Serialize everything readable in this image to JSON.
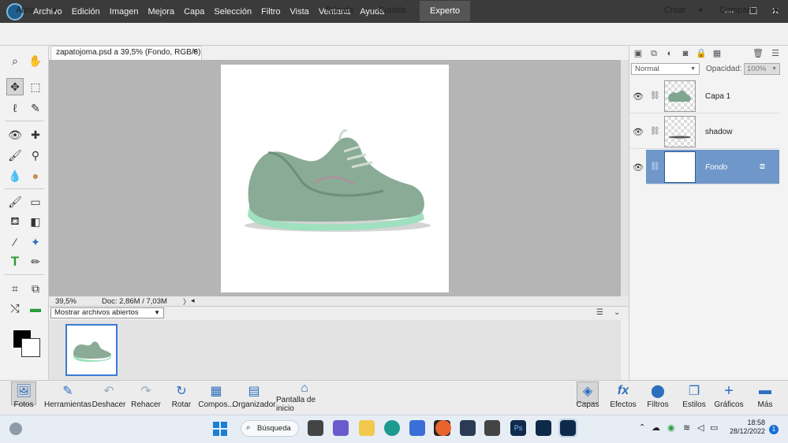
{
  "menu": [
    "Archivo",
    "Edición",
    "Imagen",
    "Mejora",
    "Capa",
    "Selección",
    "Filtro",
    "Vista",
    "Ventana",
    "Ayuda"
  ],
  "window_controls": {
    "minimize": "—",
    "maximize": "☐",
    "close": "✕"
  },
  "modebar": {
    "open": "Abrir",
    "tabs": [
      "Rápida",
      "Guiada",
      "Experto"
    ],
    "active_tab": "Experto",
    "create": "Crear",
    "share": "Compartir"
  },
  "document": {
    "tab_title": "zapatojoma.psd a 39,5% (Fondo, RGB/8)",
    "close": "×",
    "zoom": "39,5%",
    "doc_info": "Doc: 2,86M / 7,03M"
  },
  "photo_bin": {
    "selector": "Mostrar archivos abiertos"
  },
  "layers_panel": {
    "blend_mode": "Normal",
    "opacity_label": "Opacidad:",
    "opacity_value": "100%",
    "layers": [
      {
        "name": "Capa 1",
        "selected": false
      },
      {
        "name": "shadow",
        "selected": false
      },
      {
        "name": "Fondo",
        "selected": true
      }
    ]
  },
  "bottom_left": [
    {
      "label": "Fotos",
      "icon": "photos-icon"
    },
    {
      "label": "Herramientas",
      "icon": "tools-icon"
    },
    {
      "label": "Deshacer",
      "icon": "undo-icon"
    },
    {
      "label": "Rehacer",
      "icon": "redo-icon"
    },
    {
      "label": "Rotar",
      "icon": "rotate-icon"
    },
    {
      "label": "Compos...",
      "icon": "layout-icon"
    },
    {
      "label": "Organizador",
      "icon": "organizer-icon"
    },
    {
      "label": "Pantalla de inicio",
      "icon": "home-icon"
    }
  ],
  "bottom_right": [
    {
      "label": "Capas",
      "icon": "layers-icon"
    },
    {
      "label": "Efectos",
      "icon": "fx-icon"
    },
    {
      "label": "Filtros",
      "icon": "filters-icon"
    },
    {
      "label": "Estilos",
      "icon": "styles-icon"
    },
    {
      "label": "Gráficos",
      "icon": "graphics-icon"
    },
    {
      "label": "Más",
      "icon": "more-icon"
    }
  ],
  "taskbar": {
    "search": "Búsqueda",
    "time": "18:58",
    "date": "28/12/2022"
  },
  "colors": {
    "accent": "#3a7ad6",
    "selected_layer": "#6f97c9",
    "titlebar": "#3b3b3b"
  }
}
